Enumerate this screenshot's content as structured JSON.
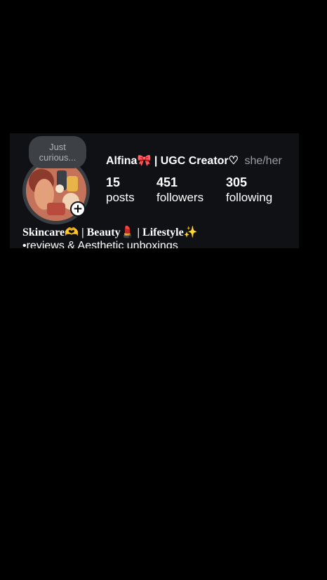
{
  "note": {
    "line1": "Just",
    "line2": "curious..."
  },
  "profile": {
    "name": "Alfina🎀 | UGC Creator♡",
    "pronouns": "she/her",
    "add_story_glyph": "+",
    "avatar_colors": {
      "background": "#c4735a",
      "accent": "#e8b44a"
    }
  },
  "stats": {
    "posts": {
      "count": "15",
      "label": "posts"
    },
    "followers": {
      "count": "451",
      "label": "followers"
    },
    "following": {
      "count": "305",
      "label": "following"
    }
  },
  "bio": {
    "title": "Skincare🫶 | Beauty💄 | Lifestyle✨",
    "line1": "•reviews & Aesthetic unboxings"
  },
  "colors": {
    "card_background": "#0f1114",
    "page_background": "#000000",
    "text_primary": "#ffffff",
    "text_secondary": "#9a9da2",
    "note_bubble": "#3d4044"
  }
}
